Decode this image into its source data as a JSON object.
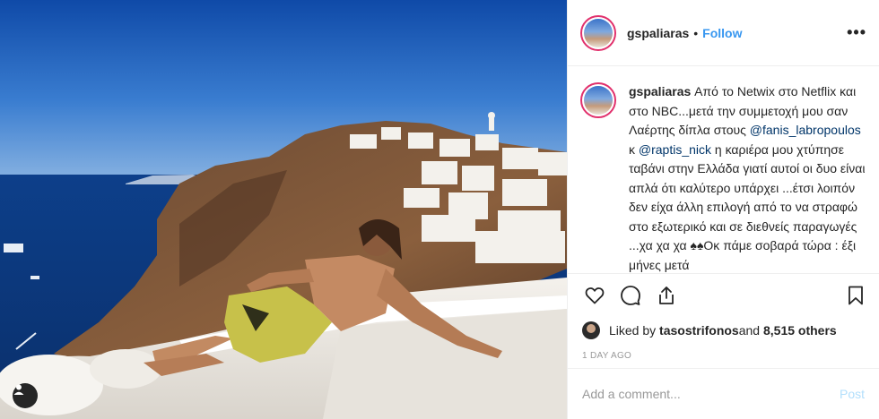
{
  "post": {
    "username": "gspaliaras",
    "separator": "•",
    "follow_label": "Follow",
    "more_label": "•••",
    "caption": {
      "username": "gspaliaras",
      "text_1": " Από το Netwix στο Netflix και στο NBC...μετά την συμμετοχή μου σαν Λαέρτης δίπλα στους ",
      "mention_1": "@fanis_labropoulos",
      "text_2": " κ ",
      "mention_2": "@raptis_nick",
      "text_3": " η καριέρα μου χτύπησε ταβάνι στην Ελλάδα γιατί αυτοί οι δυο είναι απλά ότι καλύτερο υπάρχει ...έτσι λοιπόν δεν είχα άλλη επιλογή από το να στραφώ στο εξωτερικό και σε διεθνείς παραγωγές ...χα χα χα ♠♠Οκ πάμε σοβαρά τώρα : έξι μήνες μετά"
    },
    "likes": {
      "prefix": "Liked by ",
      "user": "tasostrifonos",
      "middle": " and ",
      "count": "8,515 others"
    },
    "time_ago": "1 DAY AGO",
    "comment": {
      "placeholder": "Add a comment...",
      "post_label": "Post"
    },
    "icons": {
      "like": "heart-icon",
      "comment": "comment-icon",
      "share": "share-icon",
      "save": "bookmark-icon",
      "tag": "user-tag-icon"
    },
    "colors": {
      "follow": "#3897f0",
      "mention": "#003569",
      "story_ring": "#e1306c",
      "post_disabled": "#b2dffc"
    }
  }
}
